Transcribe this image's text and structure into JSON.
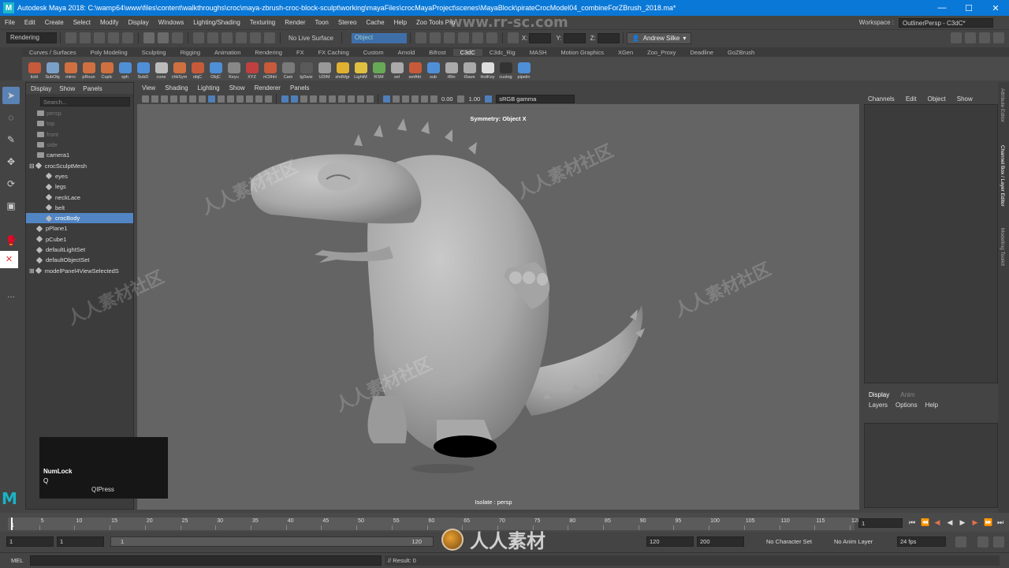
{
  "window": {
    "title": "Autodesk Maya 2018: C:\\wamp64\\www\\files\\content\\walkthroughs\\croc\\maya-zbrush-croc-block-sculpt\\working\\mayaFiles\\crocMayaProject\\scenes\\MayaBlock\\pirateCrocModel04_combineForZBrush_2018.ma*",
    "app_icon": "M"
  },
  "menubar": [
    "File",
    "Edit",
    "Create",
    "Select",
    "Modify",
    "Display",
    "Windows",
    "Lighting/Shading",
    "Texturing",
    "Render",
    "Toon",
    "Stereo",
    "Cache",
    "Help",
    "Zoo Tools Pro"
  ],
  "workspace": {
    "label": "Workspace :",
    "value": "OutlinerPersp - C3dC*"
  },
  "statusline": {
    "menuset": "Rendering",
    "live_surface": "No Live Surface",
    "object_field": "Object",
    "x_label": "X:",
    "y_label": "Y:",
    "z_label": "Z:",
    "user": "Andrew Silke"
  },
  "shelf_tabs": [
    "Curves / Surfaces",
    "Poly Modeling",
    "Sculpting",
    "Rigging",
    "Animation",
    "Rendering",
    "FX",
    "FX Caching",
    "Custom",
    "Arnold",
    "Bifrost",
    "C3dC",
    "C3dc_Rig",
    "MASH",
    "Motion Graphics",
    "XGen",
    "Zoo_Proxy",
    "Deadline",
    "GoZBrush"
  ],
  "shelf_active": "C3dC",
  "shelf_buttons": [
    {
      "label": "tickl",
      "color": "#c65a3a"
    },
    {
      "label": "SubObj",
      "color": "#7aa0c8"
    },
    {
      "label": "mirro",
      "color": "#d07040"
    },
    {
      "label": "pRoun",
      "color": "#d07040"
    },
    {
      "label": "Cuplc",
      "color": "#d07040"
    },
    {
      "label": "sph",
      "color": "#4f8fd8"
    },
    {
      "label": "SubD",
      "color": "#4f8fd8"
    },
    {
      "label": "cone",
      "color": "#bbbbbb"
    },
    {
      "label": "chkSym",
      "color": "#d07040"
    },
    {
      "label": "objC",
      "color": "#c65a3a"
    },
    {
      "label": "ObjC",
      "color": "#4f8fd8"
    },
    {
      "label": "Keyu",
      "color": "#888888"
    },
    {
      "label": "XYZ",
      "color": "#c04040"
    },
    {
      "label": "nClthH",
      "color": "#c65a3a"
    },
    {
      "label": "Cam",
      "color": "#7a7a7a"
    },
    {
      "label": "tgSwiz",
      "color": "#5a5a5a"
    },
    {
      "label": "UDIM",
      "color": "#999999"
    },
    {
      "label": "shdMgr",
      "color": "#e0b030"
    },
    {
      "label": "LightM",
      "color": "#e0c040"
    },
    {
      "label": "RSM",
      "color": "#66aa55"
    },
    {
      "label": "sel",
      "color": "#aaaaaa"
    },
    {
      "label": "setAttr",
      "color": "#c65a3a"
    },
    {
      "label": "sub",
      "color": "#4f8fd8"
    },
    {
      "label": "rBtn",
      "color": "#aaaaaa"
    },
    {
      "label": "tSave",
      "color": "#aaaaaa"
    },
    {
      "label": "HotKey",
      "color": "#dddddd"
    },
    {
      "label": "custog",
      "color": "#333333"
    },
    {
      "label": "pipelin",
      "color": "#4f8fd8"
    }
  ],
  "outliner": {
    "menu": [
      "Display",
      "Show",
      "Panels"
    ],
    "search_placeholder": "Search...",
    "items": [
      {
        "label": "persp",
        "indent": 1,
        "kind": "cam",
        "state": "dim"
      },
      {
        "label": "top",
        "indent": 1,
        "kind": "cam",
        "state": "dim"
      },
      {
        "label": "front",
        "indent": 1,
        "kind": "cam",
        "state": "dim"
      },
      {
        "label": "side",
        "indent": 1,
        "kind": "cam",
        "state": "dim"
      },
      {
        "label": "camera1",
        "indent": 1,
        "kind": "cam",
        "state": ""
      },
      {
        "label": "crocSculptMesh",
        "indent": 1,
        "kind": "grp",
        "state": "",
        "expand": "⊟"
      },
      {
        "label": "eyes",
        "indent": 2,
        "kind": "mesh",
        "state": ""
      },
      {
        "label": "legs",
        "indent": 2,
        "kind": "mesh",
        "state": ""
      },
      {
        "label": "neckLace",
        "indent": 2,
        "kind": "mesh",
        "state": ""
      },
      {
        "label": "belt",
        "indent": 2,
        "kind": "mesh",
        "state": ""
      },
      {
        "label": "crocBody",
        "indent": 2,
        "kind": "mesh",
        "state": "sel"
      },
      {
        "label": "pPlane1",
        "indent": 1,
        "kind": "mesh",
        "state": ""
      },
      {
        "label": "pCube1",
        "indent": 1,
        "kind": "mesh",
        "state": ""
      },
      {
        "label": "defaultLightSet",
        "indent": 1,
        "kind": "set",
        "state": ""
      },
      {
        "label": "defaultObjectSet",
        "indent": 1,
        "kind": "set",
        "state": ""
      },
      {
        "label": "modelPanel4ViewSelectedS",
        "indent": 1,
        "kind": "set",
        "state": "",
        "expand": "⊞"
      }
    ]
  },
  "viewport": {
    "menu": [
      "View",
      "Shading",
      "Lighting",
      "Show",
      "Renderer",
      "Panels"
    ],
    "exposure": "0.00",
    "gamma_value": "1.00",
    "colorspace": "sRGB gamma",
    "hud_top": "Symmetry: Object X",
    "hud_bottom": "Isolate : persp"
  },
  "channelbox": {
    "menu": [
      "Channels",
      "Edit",
      "Object",
      "Show"
    ]
  },
  "layers": {
    "tabs": [
      "Display",
      "Anim"
    ],
    "menu": [
      "Layers",
      "Options",
      "Help"
    ]
  },
  "side_tabs": [
    "Attribute Editor",
    "Channel Box / Layer Editor",
    "Modelling Toolkit"
  ],
  "timeline": {
    "ticks": [
      "1",
      "5",
      "10",
      "15",
      "20",
      "25",
      "30",
      "35",
      "40",
      "45",
      "50",
      "55",
      "60",
      "65",
      "70",
      "75",
      "80",
      "85",
      "90",
      "95",
      "100",
      "105",
      "110",
      "115",
      "120"
    ],
    "current_frame_label": "1",
    "current_frame_field": "1"
  },
  "rangebar": {
    "start": "1",
    "start2": "1",
    "slider_start": "1",
    "slider_end": "120",
    "end": "120",
    "end2": "200",
    "character_set": "No Character Set",
    "anim_layer": "No Anim Layer",
    "fps": "24 fps"
  },
  "cmdline": {
    "type": "MEL",
    "result": "// Result: 0"
  },
  "keyhud": {
    "line1": "NumLock",
    "line2": "Q",
    "line3": "QIPress"
  },
  "watermark": {
    "url": "www.rr-sc.com",
    "text": "人人素材社区",
    "logo_text": "人人素材"
  },
  "close_glyph": "✕",
  "more_glyph": "...",
  "maya_logo": "M"
}
